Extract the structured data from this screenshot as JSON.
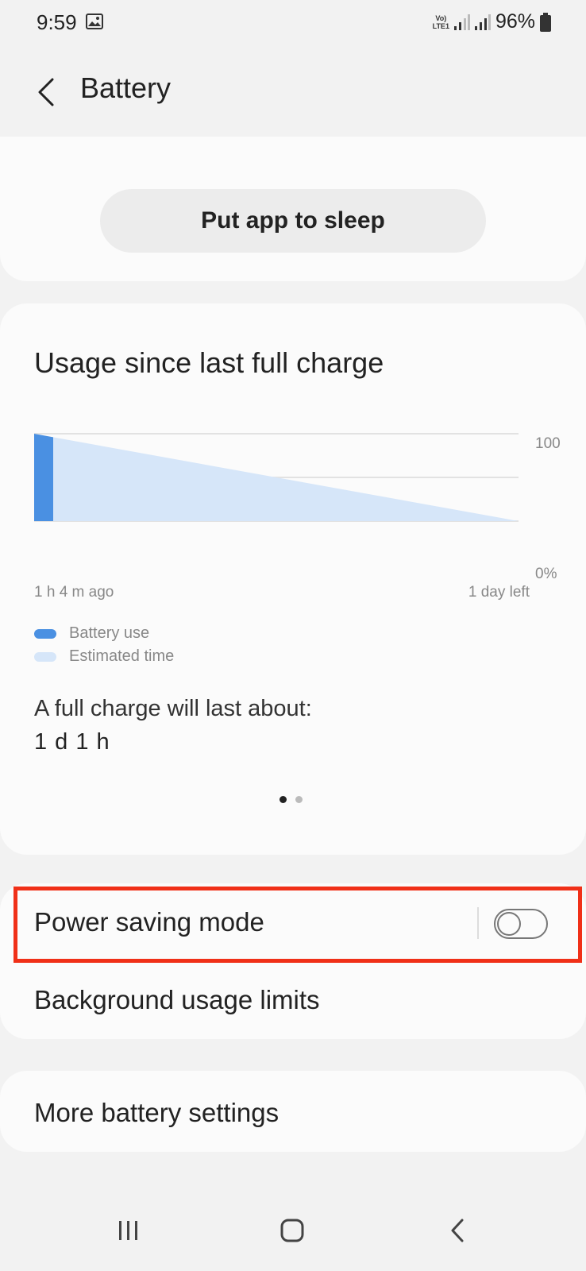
{
  "status_bar": {
    "time": "9:59",
    "network_label_top": "Vo)",
    "network_label_bottom": "LTE1",
    "battery_percent": "96%",
    "icons": [
      "gallery-icon",
      "signal-icon",
      "signal-icon",
      "battery-icon"
    ]
  },
  "header": {
    "back_icon": "chevron-left-icon",
    "title": "Battery"
  },
  "sleep_card": {
    "button_label": "Put app to sleep"
  },
  "usage_card": {
    "title": "Usage since last full charge",
    "full_charge_label": "A full charge will last about:",
    "full_charge_value": "1 d 1 h",
    "page_indicator": {
      "pages": 2,
      "active": 1
    }
  },
  "chart_data": {
    "type": "area",
    "title": "Usage since last full charge",
    "x_start_label": "1 h 4 m ago",
    "x_end_label": "1 day left",
    "y_tick_labels": [
      "100",
      "0%"
    ],
    "ylim": [
      0,
      100
    ],
    "series": [
      {
        "name": "Battery use",
        "values": [
          100,
          96
        ],
        "color": "#4a90e2"
      },
      {
        "name": "Estimated time",
        "values": [
          96,
          0
        ],
        "color": "#d6e6f9"
      }
    ],
    "legend": [
      "Battery use",
      "Estimated time"
    ],
    "legend_placement": "bottom-left",
    "grid": true
  },
  "settings": {
    "power_saving_label": "Power saving mode",
    "power_saving_enabled": false,
    "background_limits_label": "Background usage limits",
    "more_settings_label": "More battery settings"
  },
  "colors": {
    "background": "#f2f2f2",
    "card": "#fbfbfb",
    "battery_use": "#4a90e2",
    "estimated_time": "#d6e6f9",
    "highlight": "#f03018"
  },
  "nav_bar": {
    "icons": [
      "recents-icon",
      "home-icon",
      "back-icon"
    ]
  }
}
